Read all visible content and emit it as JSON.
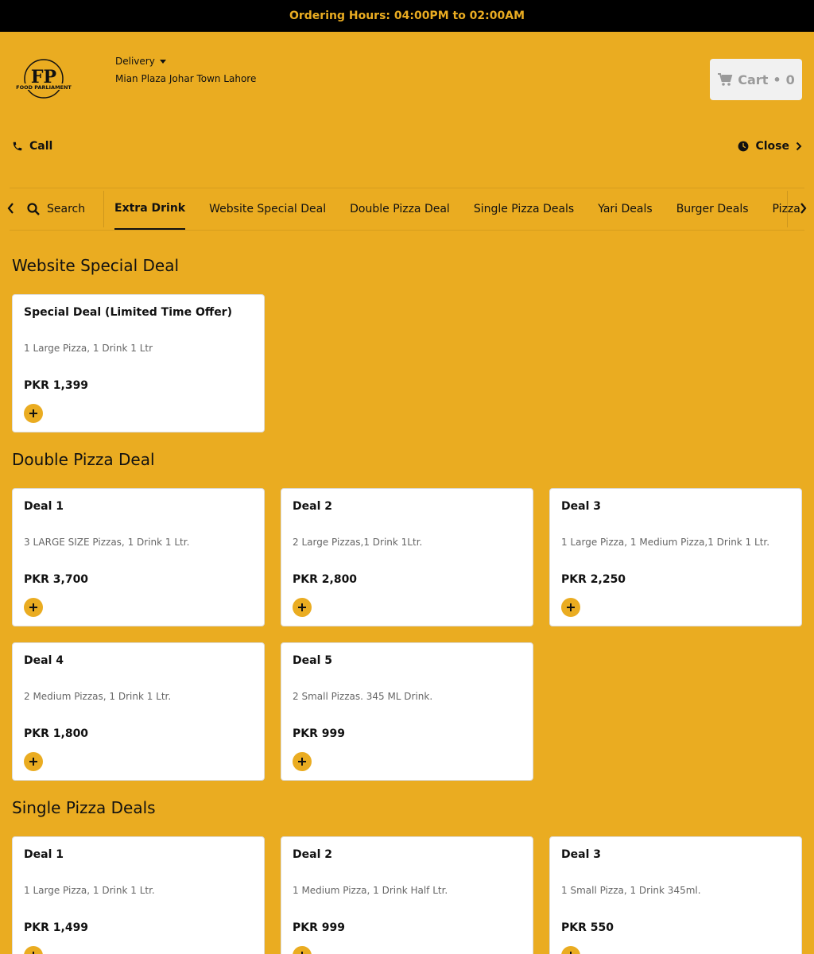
{
  "topbar": {
    "text": "Ordering Hours: 04:00PM to 02:00AM"
  },
  "header": {
    "logo_text": "FOOD PARLIAMENT",
    "logo_mark": "FP",
    "mode": "Delivery",
    "address": "Mian Plaza Johar Town Lahore",
    "cart_label": "Cart",
    "cart_sep": "•",
    "cart_count": "0"
  },
  "actions": {
    "call": "Call",
    "close": "Close"
  },
  "nav": {
    "search": "Search",
    "tabs": [
      {
        "label": "Extra Drink",
        "active": true
      },
      {
        "label": "Website Special Deal"
      },
      {
        "label": "Double Pizza Deal"
      },
      {
        "label": "Single Pizza Deals"
      },
      {
        "label": "Yari Deals"
      },
      {
        "label": "Burger Deals"
      },
      {
        "label": "Pizza"
      }
    ]
  },
  "sections": [
    {
      "title": "Website Special Deal",
      "items": [
        {
          "name": "Special Deal (Limited Time Offer)",
          "desc": "1 Large Pizza, 1 Drink 1 Ltr",
          "price": "PKR 1,399"
        }
      ]
    },
    {
      "title": "Double Pizza Deal",
      "items": [
        {
          "name": "Deal 1",
          "desc": "3 LARGE SIZE Pizzas, 1 Drink 1 Ltr.",
          "price": "PKR 3,700"
        },
        {
          "name": "Deal 2",
          "desc": "2 Large Pizzas,1 Drink 1Ltr.",
          "price": "PKR 2,800"
        },
        {
          "name": "Deal 3",
          "desc": "1 Large Pizza, 1 Medium Pizza,1 Drink 1 Ltr.",
          "price": "PKR 2,250"
        },
        {
          "name": "Deal 4",
          "desc": "2 Medium Pizzas, 1 Drink 1 Ltr.",
          "price": "PKR 1,800"
        },
        {
          "name": "Deal 5",
          "desc": "2 Small Pizzas. 345 ML Drink.",
          "price": "PKR 999"
        }
      ]
    },
    {
      "title": "Single Pizza Deals",
      "items": [
        {
          "name": "Deal 1",
          "desc": "1 Large Pizza, 1 Drink 1 Ltr.",
          "price": "PKR 1,499"
        },
        {
          "name": "Deal 2",
          "desc": "1 Medium Pizza, 1 Drink Half Ltr.",
          "price": "PKR 999"
        },
        {
          "name": "Deal 3",
          "desc": "1 Small Pizza, 1 Drink 345ml.",
          "price": "PKR 550"
        }
      ]
    }
  ]
}
